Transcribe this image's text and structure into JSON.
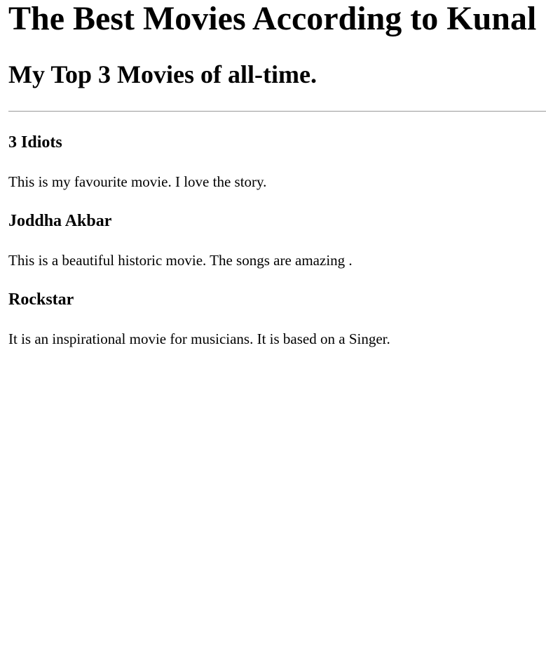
{
  "page": {
    "title": "The Best Movies According to Kunal",
    "subtitle": "My Top 3 Movies of all-time."
  },
  "movies": [
    {
      "title": "3 Idiots",
      "description": "This is my favourite movie. I love the story."
    },
    {
      "title": "Joddha Akbar",
      "description": "This is a beautiful historic movie. The songs are amazing ."
    },
    {
      "title": "Rockstar",
      "description": "It is an inspirational movie for musicians. It is based on a Singer."
    }
  ]
}
